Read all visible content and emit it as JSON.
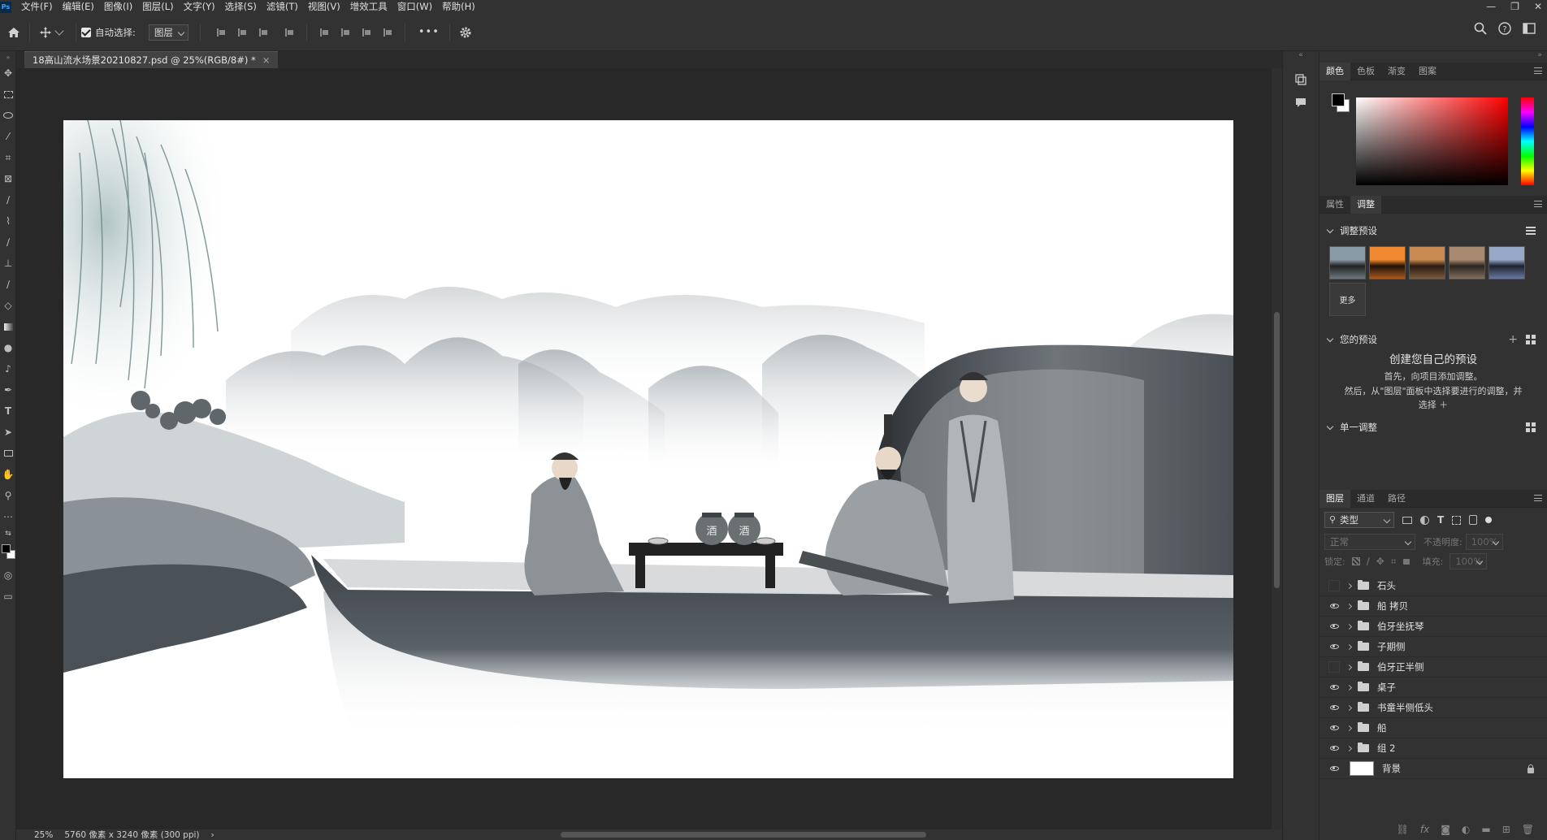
{
  "app": {
    "logo": "Ps"
  },
  "menu": [
    "文件(F)",
    "编辑(E)",
    "图像(I)",
    "图层(L)",
    "文字(Y)",
    "选择(S)",
    "滤镜(T)",
    "视图(V)",
    "增效工具",
    "窗口(W)",
    "帮助(H)"
  ],
  "window_controls": [
    "—",
    "❐",
    "✕"
  ],
  "options": {
    "auto_select_label": "自动选择:",
    "auto_select_checked": true,
    "auto_select_mode": "图层",
    "more_label": "•••"
  },
  "document": {
    "tab_title": "18高山流水场景20210827.psd @ 25%(RGB/8#) *",
    "close_glyph": "×"
  },
  "status": {
    "zoom": "25%",
    "doc_info": "5760 像素 x 3240 像素 (300 ppi)",
    "arrow": "›"
  },
  "color_panel": {
    "tabs": [
      "颜色",
      "色板",
      "渐变",
      "图案"
    ],
    "active_tab": "颜色",
    "foreground": "#000000",
    "background": "#ffffff",
    "hue_color": "#ff0000"
  },
  "adjust_panel": {
    "tabs": [
      "属性",
      "调整"
    ],
    "active_tab": "调整",
    "presets_title": "调整预设",
    "more_label": "更多",
    "your_presets_title": "您的预设",
    "create_title": "创建您自己的预设",
    "create_line1": "首先，向项目添加调整。",
    "create_line2": "然后，从\"图层\"面板中选择要进行的调整，并",
    "create_line3": "选择 ＋",
    "single_title": "单一调整"
  },
  "layers_panel": {
    "tabs": [
      "图层",
      "通道",
      "路径"
    ],
    "active_tab": "图层",
    "filter_label": "类型",
    "blend_mode": "正常",
    "opacity_label": "不透明度:",
    "opacity_value": "100%",
    "lock_label": "锁定:",
    "fill_label": "填充:",
    "fill_value": "100%",
    "layers": [
      {
        "name": "石头",
        "visible": false,
        "type": "folder"
      },
      {
        "name": "船 拷贝",
        "visible": true,
        "type": "folder"
      },
      {
        "name": "伯牙坐抚琴",
        "visible": true,
        "type": "folder"
      },
      {
        "name": "子期侧",
        "visible": true,
        "type": "folder"
      },
      {
        "name": "伯牙正半侧",
        "visible": false,
        "type": "folder"
      },
      {
        "name": "桌子",
        "visible": true,
        "type": "folder"
      },
      {
        "name": "书童半侧低头",
        "visible": true,
        "type": "folder"
      },
      {
        "name": "船",
        "visible": true,
        "type": "folder"
      },
      {
        "name": "组 2",
        "visible": true,
        "type": "folder"
      },
      {
        "name": "背景",
        "visible": true,
        "type": "background",
        "locked": true
      }
    ],
    "footer_icons": [
      "link-icon",
      "fx-icon",
      "mask-icon",
      "adjustment-icon",
      "group-icon",
      "new-layer-icon",
      "trash-icon"
    ]
  },
  "artwork": {
    "jar_label_1": "酒",
    "jar_label_2": "酒"
  }
}
